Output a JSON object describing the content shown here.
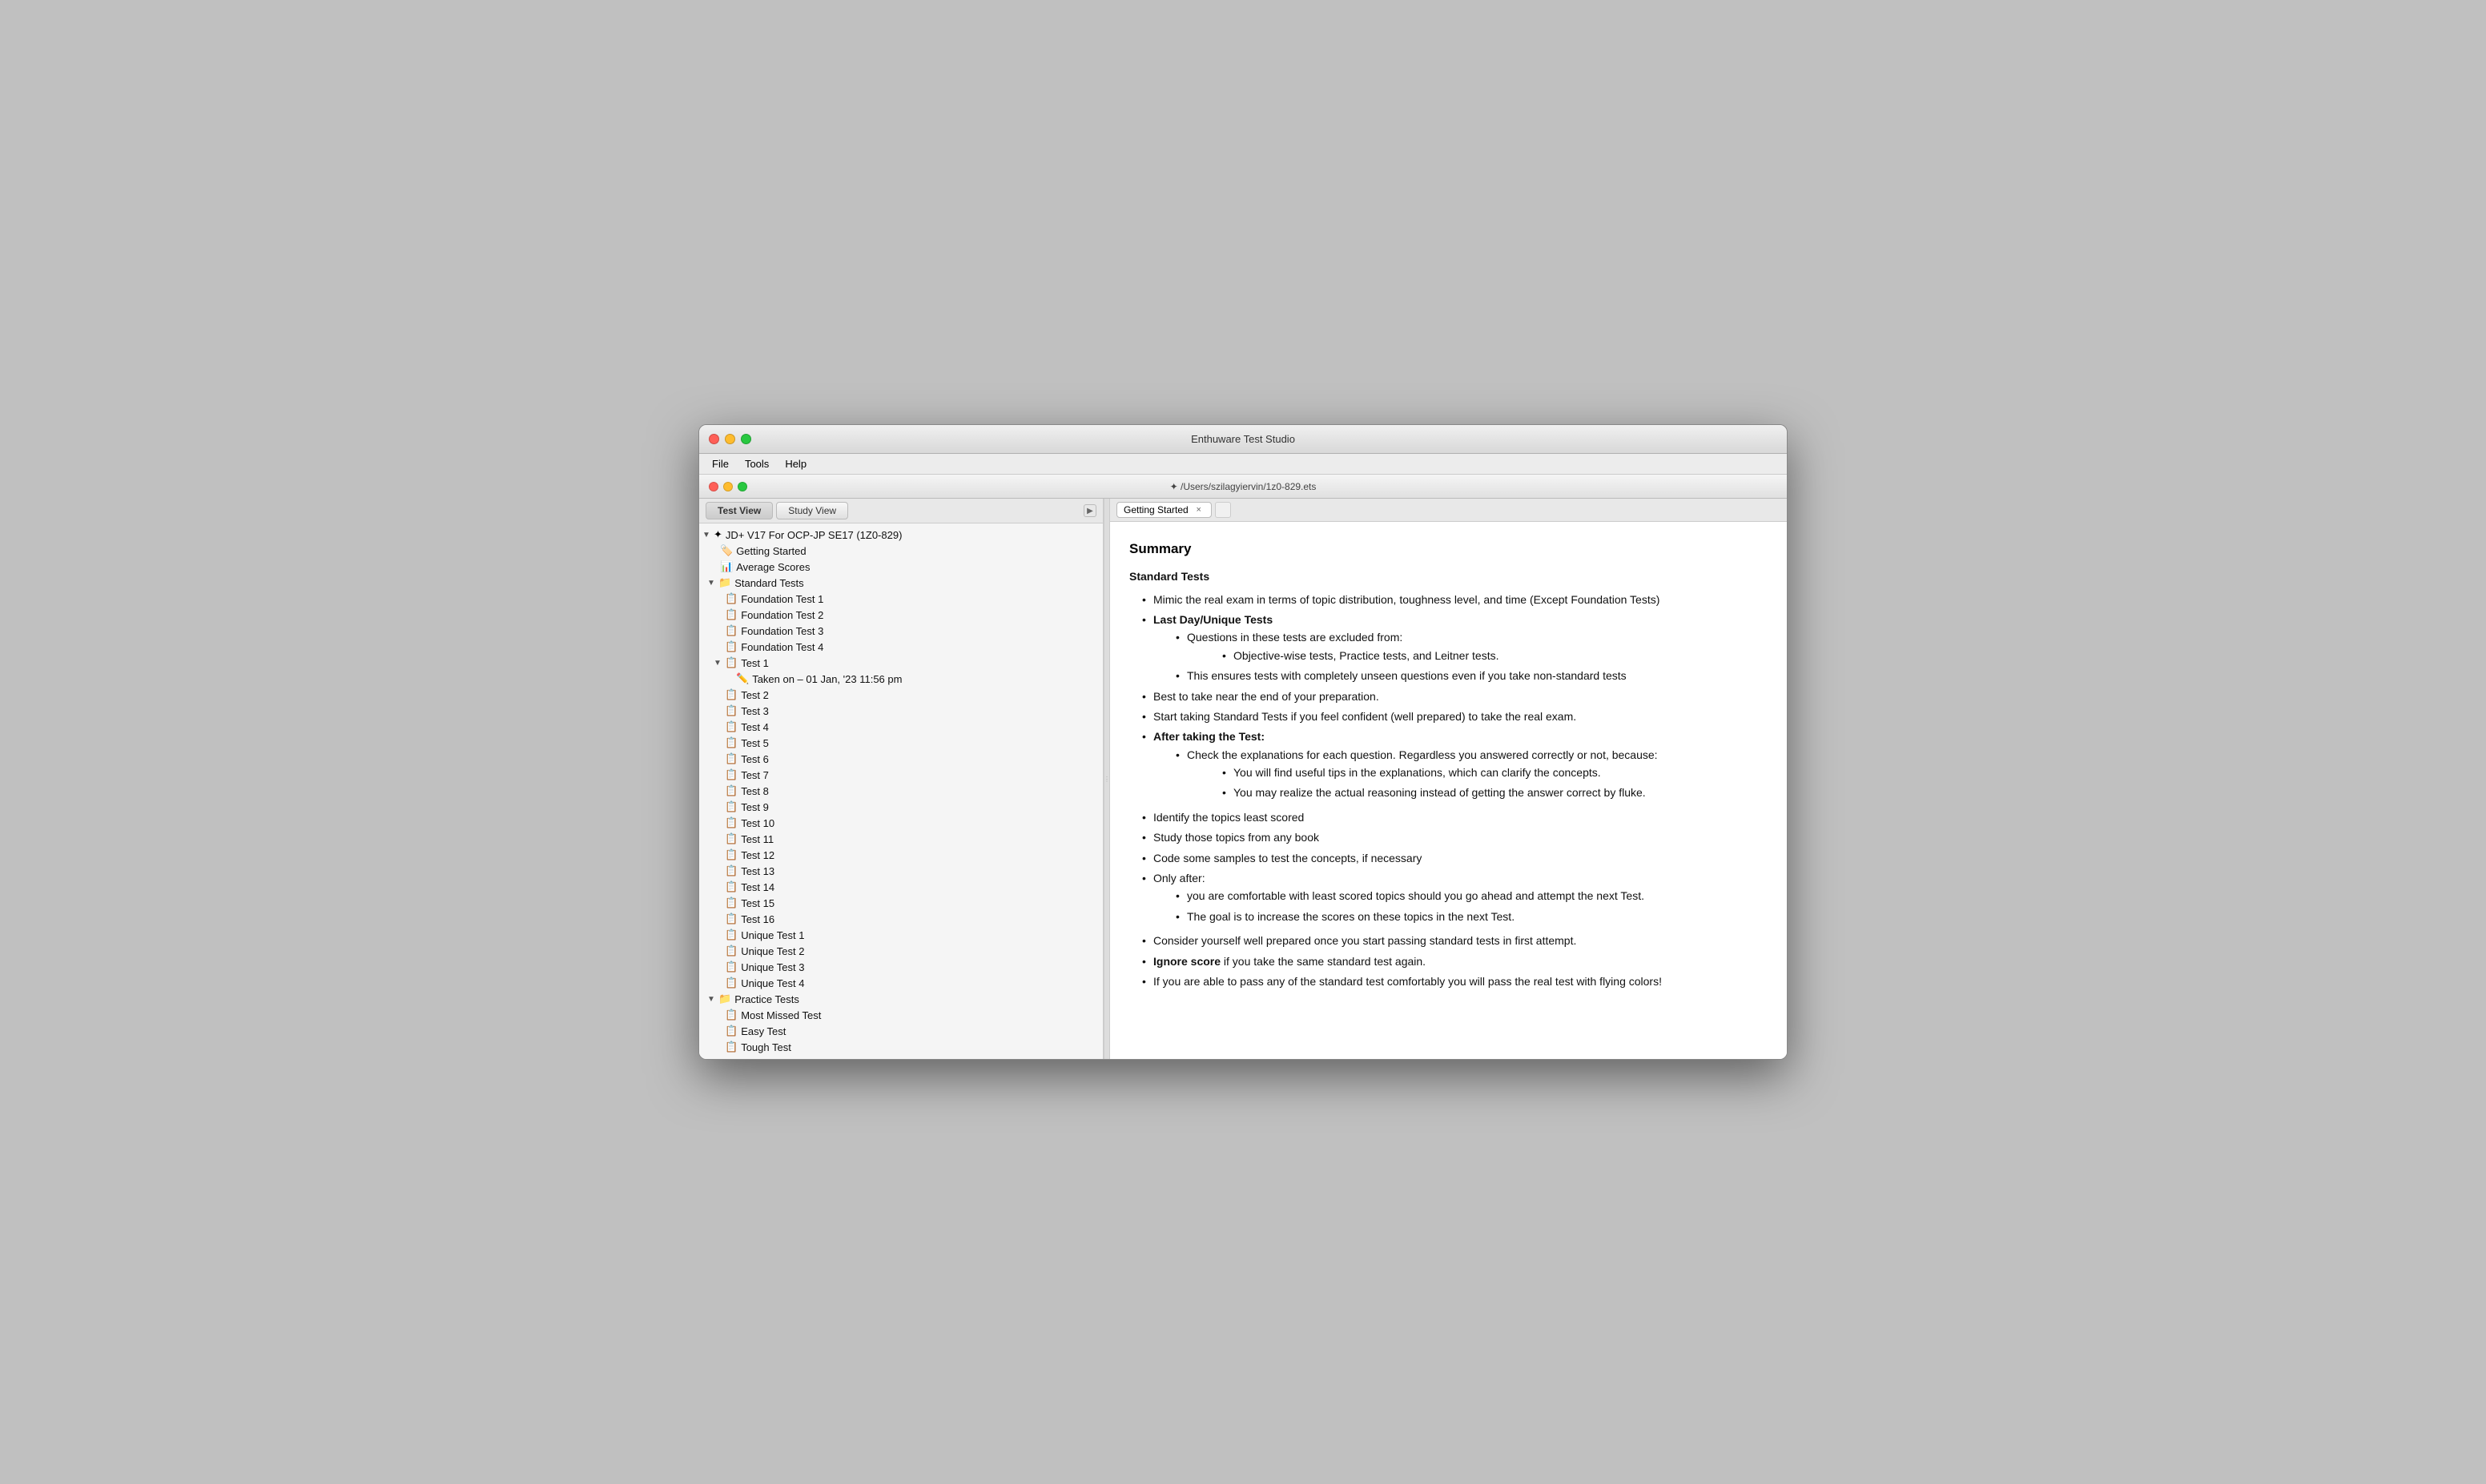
{
  "app": {
    "title": "Enthuware Test Studio",
    "inner_title": "✦ /Users/szilagyiervin/1z0-829.ets"
  },
  "menu": {
    "items": [
      "File",
      "Tools",
      "Help"
    ]
  },
  "left_panel": {
    "tabs": [
      {
        "label": "Test View",
        "active": true
      },
      {
        "label": "Study View",
        "active": false
      }
    ],
    "tree": {
      "root_label": "JD+ V17 For OCP-JP SE17 (1Z0-829)",
      "items": [
        {
          "id": "getting-started",
          "label": "Getting Started",
          "level": 1,
          "type": "page"
        },
        {
          "id": "average-scores",
          "label": "Average Scores",
          "level": 1,
          "type": "chart"
        },
        {
          "id": "standard-tests",
          "label": "Standard Tests",
          "level": 1,
          "type": "folder",
          "expanded": true
        },
        {
          "id": "foundation-test-1",
          "label": "Foundation Test 1",
          "level": 2,
          "type": "test"
        },
        {
          "id": "foundation-test-2",
          "label": "Foundation Test 2",
          "level": 2,
          "type": "test"
        },
        {
          "id": "foundation-test-3",
          "label": "Foundation Test 3",
          "level": 2,
          "type": "test"
        },
        {
          "id": "foundation-test-4",
          "label": "Foundation Test 4",
          "level": 2,
          "type": "test"
        },
        {
          "id": "test-1",
          "label": "Test 1",
          "level": 2,
          "type": "test",
          "expanded": true
        },
        {
          "id": "taken-on",
          "label": "Taken on - 01 Jan, '23 11:56 pm",
          "level": 3,
          "type": "taken"
        },
        {
          "id": "test-2",
          "label": "Test 2",
          "level": 2,
          "type": "test"
        },
        {
          "id": "test-3",
          "label": "Test 3",
          "level": 2,
          "type": "test"
        },
        {
          "id": "test-4",
          "label": "Test 4",
          "level": 2,
          "type": "test"
        },
        {
          "id": "test-5",
          "label": "Test 5",
          "level": 2,
          "type": "test"
        },
        {
          "id": "test-6",
          "label": "Test 6",
          "level": 2,
          "type": "test"
        },
        {
          "id": "test-7",
          "label": "Test 7",
          "level": 2,
          "type": "test"
        },
        {
          "id": "test-8",
          "label": "Test 8",
          "level": 2,
          "type": "test"
        },
        {
          "id": "test-9",
          "label": "Test 9",
          "level": 2,
          "type": "test"
        },
        {
          "id": "test-10",
          "label": "Test 10",
          "level": 2,
          "type": "test"
        },
        {
          "id": "test-11",
          "label": "Test 11",
          "level": 2,
          "type": "test"
        },
        {
          "id": "test-12",
          "label": "Test 12",
          "level": 2,
          "type": "test"
        },
        {
          "id": "test-13",
          "label": "Test 13",
          "level": 2,
          "type": "test"
        },
        {
          "id": "test-14",
          "label": "Test 14",
          "level": 2,
          "type": "test"
        },
        {
          "id": "test-15",
          "label": "Test 15",
          "level": 2,
          "type": "test"
        },
        {
          "id": "test-16",
          "label": "Test 16",
          "level": 2,
          "type": "test"
        },
        {
          "id": "unique-test-1",
          "label": "Unique Test 1",
          "level": 2,
          "type": "test"
        },
        {
          "id": "unique-test-2",
          "label": "Unique Test 2",
          "level": 2,
          "type": "test"
        },
        {
          "id": "unique-test-3",
          "label": "Unique Test 3",
          "level": 2,
          "type": "test"
        },
        {
          "id": "unique-test-4",
          "label": "Unique Test 4",
          "level": 2,
          "type": "test"
        },
        {
          "id": "practice-tests",
          "label": "Practice Tests",
          "level": 1,
          "type": "folder",
          "expanded": true
        },
        {
          "id": "most-missed-test",
          "label": "Most Missed Test",
          "level": 2,
          "type": "test"
        },
        {
          "id": "easy-test",
          "label": "Easy Test",
          "level": 2,
          "type": "test"
        },
        {
          "id": "tough-test",
          "label": "Tough Test",
          "level": 2,
          "type": "test"
        }
      ]
    }
  },
  "right_panel": {
    "tab_label": "Getting Started",
    "tab_close": "×",
    "content": {
      "heading": "Summary",
      "section_standard_tests": "Standard Tests",
      "bullets": [
        "Mimic the real exam in terms of topic distribution, toughness level, and time (Except Foundation Tests)",
        "Last Day/Unique Tests",
        "Questions in these tests are excluded from:",
        "Objective-wise tests, Practice tests, and Leitner tests.",
        "This ensures tests with completely unseen questions even if you take non-standard tests",
        "Best to take near the end of your preparation.",
        "Start taking Standard Tests if you feel confident (well prepared) to take the real exam.",
        "After taking the Test:",
        "Check the explanations for each question. Regardless you answered correctly or not, because:",
        "You will find useful tips in the explanations, which can clarify the concepts.",
        "You may realize the actual reasoning instead of getting the answer correct by fluke.",
        "Identify the topics least scored",
        "Study those topics from any book",
        "Code some samples to test the concepts, if necessary",
        "Only after:",
        "you are comfortable with least scored topics should you go ahead and attempt the next Test.",
        "The goal is to increase the scores on these topics in the next Test.",
        "Consider yourself well prepared once you start passing standard tests in first attempt.",
        "Ignore score if you take the same standard test again.",
        "If you are able to pass any of the standard test comfortably you will pass the real test with flying colors!"
      ]
    }
  }
}
